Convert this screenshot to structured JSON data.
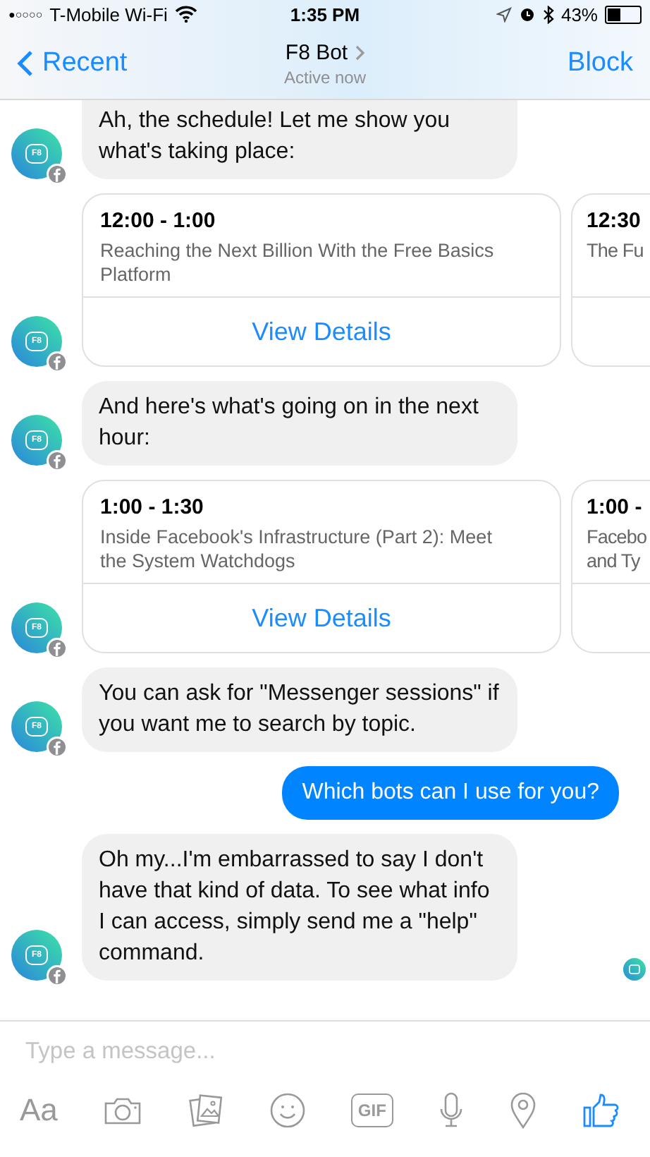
{
  "status_bar": {
    "signal_bars": "●○○○○",
    "carrier": "T-Mobile Wi-Fi",
    "time": "1:35 PM",
    "battery": "43%"
  },
  "nav": {
    "back": "Recent",
    "title": "F8 Bot",
    "subtitle": "Active now",
    "action": "Block"
  },
  "messages": [
    {
      "kind": "bot_text",
      "avatar": "F8",
      "text": "Ah, the schedule! Let me show you what's taking place:"
    },
    {
      "kind": "cards",
      "avatar": "F8",
      "cards": [
        {
          "time": "12:00 - 1:00",
          "title": "Reaching the Next Billion With the Free Basics Platform",
          "button": "View Details"
        },
        {
          "time": "12:30",
          "title": "The Fu"
        }
      ]
    },
    {
      "kind": "bot_text",
      "avatar": "F8",
      "text": "And here's what's going on in the next hour:"
    },
    {
      "kind": "cards",
      "avatar": "F8",
      "cards": [
        {
          "time": "1:00 - 1:30",
          "title": "Inside Facebook's Infrastructure (Part 2): Meet the System Watchdogs",
          "button": "View Details"
        },
        {
          "time": "1:00 -",
          "title": "Facebo\nand Ty"
        }
      ]
    },
    {
      "kind": "bot_text",
      "avatar": "F8",
      "text": "You can ask for \"Messenger sessions\" if you want me to search by topic."
    },
    {
      "kind": "user_text",
      "text": "Which bots can I use for you?"
    },
    {
      "kind": "bot_text",
      "avatar": "F8",
      "text": "Oh my...I'm embarrassed to say I don't have that kind of data. To see what info I can access, simply send me a \"help\" command.",
      "seen": true
    }
  ],
  "composer": {
    "placeholder": "Type a message...",
    "text_button": "Aa",
    "gif_button": "GIF"
  }
}
